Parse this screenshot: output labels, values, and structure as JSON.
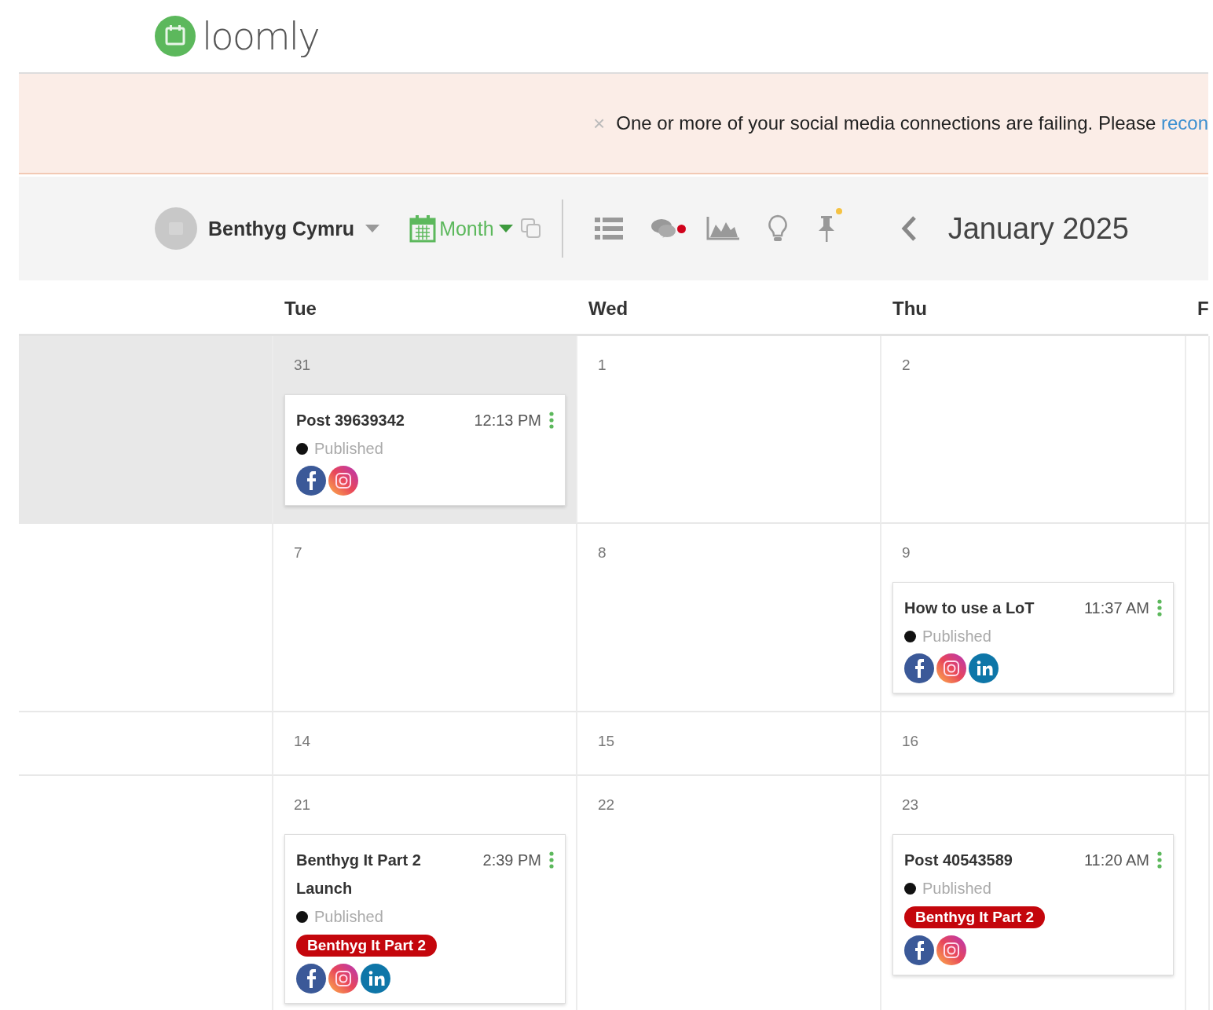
{
  "brand": {
    "name": "loomly"
  },
  "banner": {
    "close": "×",
    "message": "One or more of your social media connections are failing. Please",
    "link": "recon"
  },
  "toolbar": {
    "account": "Benthyg Cymru",
    "view": "Month",
    "notifications_unread": true,
    "pins_unread": true,
    "period": "January 2025"
  },
  "calendar": {
    "columns": [
      {},
      {
        "label": "Tue"
      },
      {
        "label": "Wed"
      },
      {
        "label": "Thu"
      },
      {
        "label": "F"
      }
    ],
    "weeks": [
      {
        "cells": [
          {
            "outside_month": true
          },
          {
            "date": "31",
            "outside_month": true,
            "posts": [
              {
                "title": "Post 39639342",
                "time": "12:13 PM",
                "status": "Published",
                "networks": [
                  {
                    "kind": "facebook"
                  },
                  {
                    "kind": "instagram"
                  }
                ]
              }
            ]
          },
          {
            "date": "1",
            "outside_month": false
          },
          {
            "date": "2",
            "outside_month": false
          },
          {
            "outside_month": false
          }
        ]
      },
      {
        "cells": [
          {
            "outside_month": false
          },
          {
            "date": "7",
            "outside_month": false
          },
          {
            "date": "8",
            "outside_month": false
          },
          {
            "date": "9",
            "outside_month": false,
            "posts": [
              {
                "title": "How to use a LoT",
                "time": "11:37 AM",
                "status": "Published",
                "networks": [
                  {
                    "kind": "facebook"
                  },
                  {
                    "kind": "instagram"
                  },
                  {
                    "kind": "linkedin"
                  }
                ]
              }
            ]
          },
          {
            "outside_month": false
          }
        ]
      },
      {
        "cells": [
          {
            "outside_month": false
          },
          {
            "date": "14",
            "outside_month": false
          },
          {
            "date": "15",
            "outside_month": false
          },
          {
            "date": "16",
            "outside_month": false
          },
          {
            "outside_month": false
          }
        ]
      },
      {
        "cells": [
          {
            "outside_month": false
          },
          {
            "date": "21",
            "outside_month": false,
            "posts": [
              {
                "title": "Benthyg It Part 2 Launch",
                "time": "2:39 PM",
                "status": "Published",
                "tags": [
                  "Benthyg It Part 2"
                ],
                "networks": [
                  {
                    "kind": "facebook"
                  },
                  {
                    "kind": "instagram"
                  },
                  {
                    "kind": "linkedin"
                  }
                ]
              }
            ]
          },
          {
            "date": "22",
            "outside_month": false
          },
          {
            "date": "23",
            "outside_month": false,
            "posts": [
              {
                "title": "Post 40543589",
                "time": "11:20 AM",
                "status": "Published",
                "tags": [
                  "Benthyg It Part 2"
                ],
                "networks": [
                  {
                    "kind": "facebook"
                  },
                  {
                    "kind": "instagram"
                  }
                ]
              }
            ]
          },
          {
            "outside_month": false
          }
        ]
      }
    ]
  }
}
